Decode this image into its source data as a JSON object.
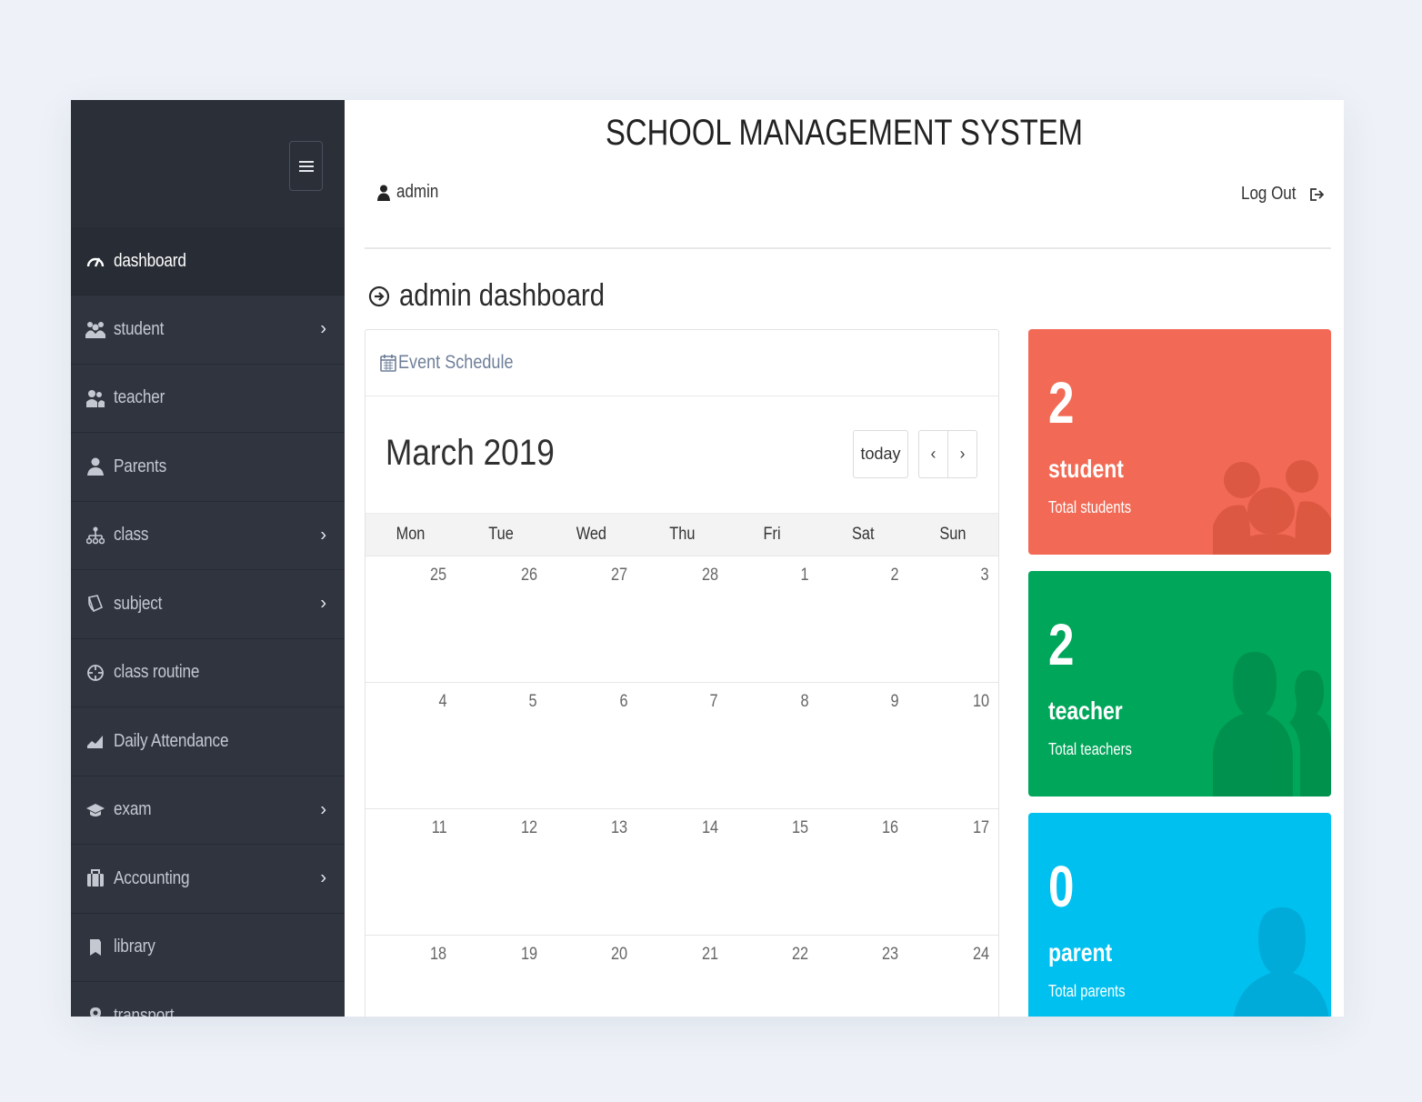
{
  "app": {
    "title": "SCHOOL MANAGEMENT SYSTEM"
  },
  "header": {
    "username": "admin",
    "logout_label": "Log Out"
  },
  "page": {
    "heading": "admin dashboard"
  },
  "sidebar": {
    "items": [
      {
        "label": "dashboard",
        "icon": "dashboard-icon",
        "active": true,
        "has_children": false
      },
      {
        "label": "student",
        "icon": "users-icon",
        "active": false,
        "has_children": true
      },
      {
        "label": "teacher",
        "icon": "teacher-icon",
        "active": false,
        "has_children": false
      },
      {
        "label": "Parents",
        "icon": "user-icon",
        "active": false,
        "has_children": false
      },
      {
        "label": "class",
        "icon": "sitemap-icon",
        "active": false,
        "has_children": true
      },
      {
        "label": "subject",
        "icon": "book-icon",
        "active": false,
        "has_children": true
      },
      {
        "label": "class routine",
        "icon": "target-icon",
        "active": false,
        "has_children": false
      },
      {
        "label": "Daily Attendance",
        "icon": "area-chart-icon",
        "active": false,
        "has_children": false
      },
      {
        "label": "exam",
        "icon": "graduation-cap-icon",
        "active": false,
        "has_children": true
      },
      {
        "label": "Accounting",
        "icon": "briefcase-icon",
        "active": false,
        "has_children": true
      },
      {
        "label": "library",
        "icon": "bookmark-icon",
        "active": false,
        "has_children": false
      },
      {
        "label": "transport",
        "icon": "map-marker-icon",
        "active": false,
        "has_children": false
      }
    ]
  },
  "calendar": {
    "panel_title": "Event Schedule",
    "month_title": "March 2019",
    "today_label": "today",
    "prev_label": "‹",
    "next_label": "›",
    "weekdays": [
      "Mon",
      "Tue",
      "Wed",
      "Thu",
      "Fri",
      "Sat",
      "Sun"
    ],
    "weeks": [
      [
        "25",
        "26",
        "27",
        "28",
        "1",
        "2",
        "3"
      ],
      [
        "4",
        "5",
        "6",
        "7",
        "8",
        "9",
        "10"
      ],
      [
        "11",
        "12",
        "13",
        "14",
        "15",
        "16",
        "17"
      ],
      [
        "18",
        "19",
        "20",
        "21",
        "22",
        "23",
        "24"
      ]
    ]
  },
  "stats": [
    {
      "count": "2",
      "title": "student",
      "subtitle": "Total students",
      "color": "#f26a55",
      "icon": "users-icon"
    },
    {
      "count": "2",
      "title": "teacher",
      "subtitle": "Total teachers",
      "color": "#00a65a",
      "icon": "teacher-icon"
    },
    {
      "count": "0",
      "title": "parent",
      "subtitle": "Total parents",
      "color": "#00c0ef",
      "icon": "user-icon"
    }
  ],
  "colors": {
    "sidebar_bg": "#2f343f",
    "accent_red": "#f26a55",
    "accent_green": "#00a65a",
    "accent_blue": "#00c0ef"
  }
}
